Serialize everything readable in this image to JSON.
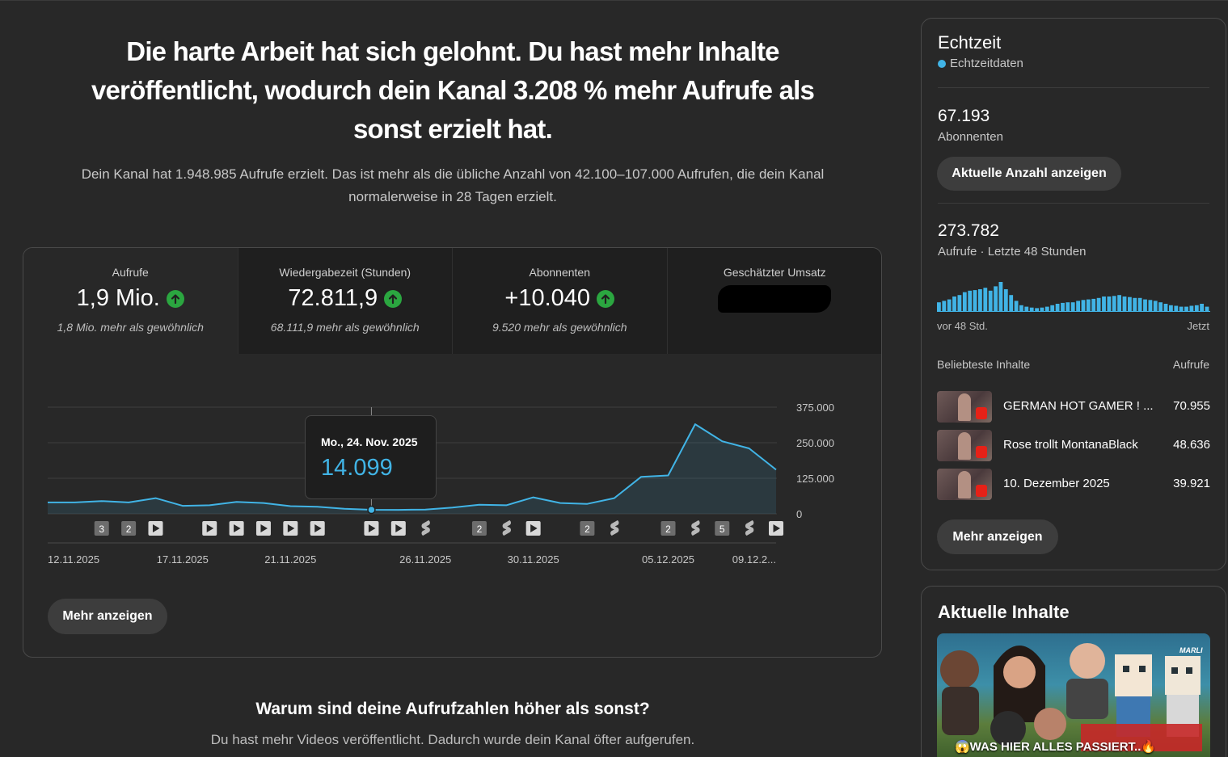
{
  "headline": "Die harte Arbeit hat sich gelohnt. Du hast mehr Inhalte veröffentlicht, wodurch dein Kanal 3.208 % mehr Aufrufe als sonst erzielt hat.",
  "subline": "Dein Kanal hat 1.948.985 Aufrufe erzielt. Das ist mehr als die übliche Anzahl von 42.100–107.000 Aufrufen, die dein Kanal normalerweise in 28 Tagen erzielt.",
  "metrics": [
    {
      "label": "Aufrufe",
      "value": "1,9 Mio.",
      "note": "1,8 Mio. mehr als gewöhnlich"
    },
    {
      "label": "Wiedergabezeit (Stunden)",
      "value": "72.811,9",
      "note": "68.111,9 mehr als gewöhnlich"
    },
    {
      "label": "Abonnenten",
      "value": "+10.040",
      "note": "9.520 mehr als gewöhnlich"
    },
    {
      "label": "Geschätzter Umsatz",
      "value": "",
      "note": ""
    }
  ],
  "tooltip": {
    "date": "Mo., 24. Nov. 2025",
    "value": "14.099"
  },
  "chart_data": {
    "type": "area",
    "x": [
      "12.11.2025",
      "13.11.2025",
      "14.11.2025",
      "15.11.2025",
      "16.11.2025",
      "17.11.2025",
      "18.11.2025",
      "19.11.2025",
      "20.11.2025",
      "21.11.2025",
      "22.11.2025",
      "23.11.2025",
      "24.11.2025",
      "25.11.2025",
      "26.11.2025",
      "27.11.2025",
      "28.11.2025",
      "29.11.2025",
      "30.11.2025",
      "01.12.2025",
      "02.12.2025",
      "03.12.2025",
      "04.12.2025",
      "05.12.2025",
      "06.12.2025",
      "07.12.2025",
      "08.12.2025",
      "09.12.2025"
    ],
    "values": [
      40000,
      40000,
      45000,
      40000,
      55000,
      28000,
      30000,
      42000,
      38000,
      27000,
      25000,
      18000,
      14099,
      14000,
      15000,
      22000,
      32000,
      30000,
      58000,
      38000,
      35000,
      55000,
      130000,
      135000,
      315000,
      255000,
      230000,
      155000
    ],
    "x_tick_labels": [
      "12.11.2025",
      "17.11.2025",
      "21.11.2025",
      "26.11.2025",
      "30.11.2025",
      "05.12.2025",
      "09.12.2..."
    ],
    "y_ticks": [
      "375.000",
      "250.000",
      "125.000",
      "0"
    ],
    "ylim": [
      0,
      375000
    ],
    "grid": true,
    "color": "#41b4e6",
    "markers": [
      {
        "date": "14.11.2025",
        "kind": "count",
        "label": "3"
      },
      {
        "date": "15.11.2025",
        "kind": "count",
        "label": "2"
      },
      {
        "date": "16.11.2025",
        "kind": "video"
      },
      {
        "date": "18.11.2025",
        "kind": "video"
      },
      {
        "date": "19.11.2025",
        "kind": "video"
      },
      {
        "date": "20.11.2025",
        "kind": "video"
      },
      {
        "date": "21.11.2025",
        "kind": "video"
      },
      {
        "date": "22.11.2025",
        "kind": "video"
      },
      {
        "date": "24.11.2025",
        "kind": "video"
      },
      {
        "date": "25.11.2025",
        "kind": "video"
      },
      {
        "date": "26.11.2025",
        "kind": "shorts"
      },
      {
        "date": "28.11.2025",
        "kind": "count",
        "label": "2"
      },
      {
        "date": "29.11.2025",
        "kind": "shorts"
      },
      {
        "date": "30.11.2025",
        "kind": "video"
      },
      {
        "date": "02.12.2025",
        "kind": "count",
        "label": "2"
      },
      {
        "date": "03.12.2025",
        "kind": "shorts"
      },
      {
        "date": "05.12.2025",
        "kind": "count",
        "label": "2"
      },
      {
        "date": "06.12.2025",
        "kind": "shorts"
      },
      {
        "date": "07.12.2025",
        "kind": "count",
        "label": "5"
      },
      {
        "date": "08.12.2025",
        "kind": "shorts"
      },
      {
        "date": "09.12.2025",
        "kind": "video"
      }
    ]
  },
  "main_more_label": "Mehr anzeigen",
  "why": {
    "title": "Warum sind deine Aufrufzahlen höher als sonst?",
    "text": "Du hast mehr Videos veröffentlicht. Dadurch wurde dein Kanal öfter aufgerufen."
  },
  "realtime": {
    "title": "Echtzeit",
    "live_label": "Echtzeitdaten",
    "subscribers": "67.193",
    "subscribers_label": "Abonnenten",
    "count_button": "Aktuelle Anzahl anzeigen",
    "views": "273.782",
    "views_label": "Aufrufe · Letzte 48 Stunden",
    "axis_start": "vor 48 Std.",
    "axis_end": "Jetzt",
    "mini_bars": [
      0.3,
      0.35,
      0.4,
      0.5,
      0.55,
      0.65,
      0.7,
      0.72,
      0.75,
      0.8,
      0.7,
      0.85,
      1.0,
      0.75,
      0.55,
      0.35,
      0.2,
      0.15,
      0.12,
      0.1,
      0.12,
      0.15,
      0.2,
      0.25,
      0.28,
      0.3,
      0.3,
      0.35,
      0.38,
      0.4,
      0.42,
      0.45,
      0.5,
      0.5,
      0.52,
      0.55,
      0.5,
      0.48,
      0.45,
      0.45,
      0.4,
      0.38,
      0.35,
      0.3,
      0.25,
      0.2,
      0.18,
      0.15,
      0.15,
      0.18,
      0.2,
      0.25,
      0.15
    ],
    "table_header_left": "Beliebteste Inhalte",
    "table_header_right": "Aufrufe",
    "top_content": [
      {
        "title": "GERMAN HOT GAMER ! ...",
        "views": "70.955"
      },
      {
        "title": "Rose trollt MontanaBlack",
        "views": "48.636"
      },
      {
        "title": "10. Dezember 2025",
        "views": "39.921"
      }
    ],
    "more_label": "Mehr anzeigen"
  },
  "latest": {
    "title": "Aktuelle Inhalte",
    "caption": "😱WAS HIER ALLES PASSIERT..🔥",
    "thumb_tag": "MARLI"
  }
}
